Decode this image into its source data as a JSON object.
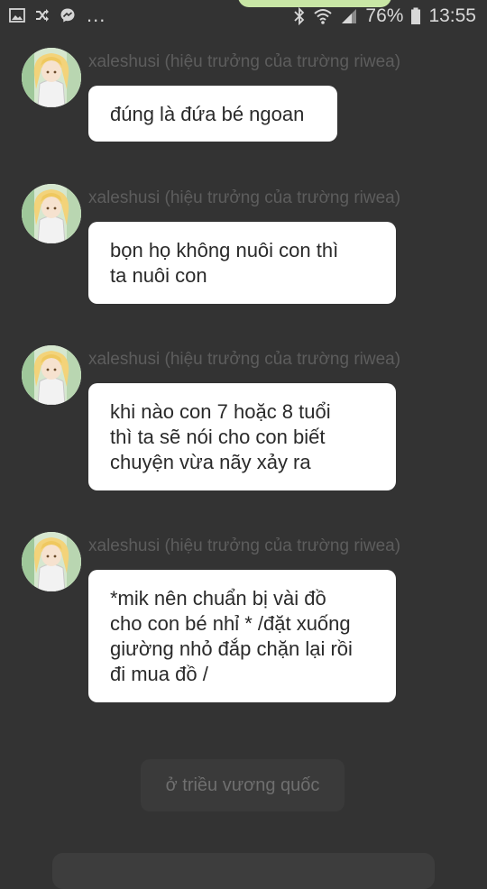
{
  "status_bar": {
    "left_icons": [
      "image-icon",
      "shuffle-icon",
      "messenger-icon"
    ],
    "more": "...",
    "right_icons": [
      "bluetooth-icon",
      "wifi-icon",
      "signal-icon"
    ],
    "battery": "76%",
    "time": "13:55"
  },
  "messages": [
    {
      "author": "xaleshusi (hiệu trưởng của trường riwea)",
      "lines": [
        "đúng là đứa bé ngoan"
      ]
    },
    {
      "author": "xaleshusi (hiệu trưởng của trường riwea)",
      "lines": [
        "bọn họ không nuôi con thì",
        "ta nuôi con"
      ]
    },
    {
      "author": "xaleshusi (hiệu trưởng của trường riwea)",
      "lines": [
        "khi nào con 7 hoặc 8 tuổi",
        "thì ta sẽ nói cho con biết",
        "chuyện vừa nãy xảy ra"
      ]
    },
    {
      "author": "xaleshusi (hiệu trưởng của trường riwea)",
      "lines": [
        "*mik nên chuẩn bị vài đồ",
        "cho con bé nhỉ * /đặt xuống",
        "giường nhỏ đắp chặn lại rồi",
        "đi mua đồ /"
      ]
    }
  ],
  "pending": {
    "label": "ở triều vương quốc"
  },
  "colors": {
    "background": "#333333",
    "bubble": "#ffffff",
    "author": "#5d5d5d",
    "accent_pill": "#c8e6a5"
  }
}
